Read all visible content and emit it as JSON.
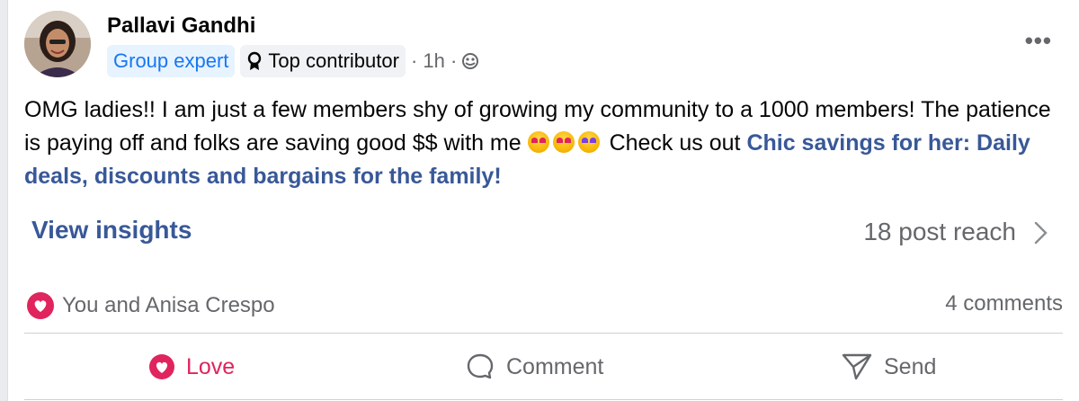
{
  "post": {
    "author": "Pallavi Gandhi",
    "badges": {
      "expert": "Group expert",
      "contributor": "Top contributor"
    },
    "time": "· 1h ·",
    "body_text": "OMG ladies!! I am just a few members shy of growing my  community to a 1000 members! The patience is paying off and folks are saving good $$ with me",
    "body_after_emoji": "Check us out",
    "link_text": "Chic savings for her: Daily deals, discounts and bargains for the family!",
    "more_label": "•••"
  },
  "insights": {
    "view_label": "View insights",
    "reach_label": "18 post reach"
  },
  "reactions": {
    "names": "You and Anisa Crespo",
    "comments": "4 comments"
  },
  "actions": {
    "love": "Love",
    "comment": "Comment",
    "send": "Send"
  },
  "colors": {
    "link": "#385898",
    "love": "#e0245e",
    "expert_badge": "#1877f2",
    "muted": "#65676b"
  }
}
